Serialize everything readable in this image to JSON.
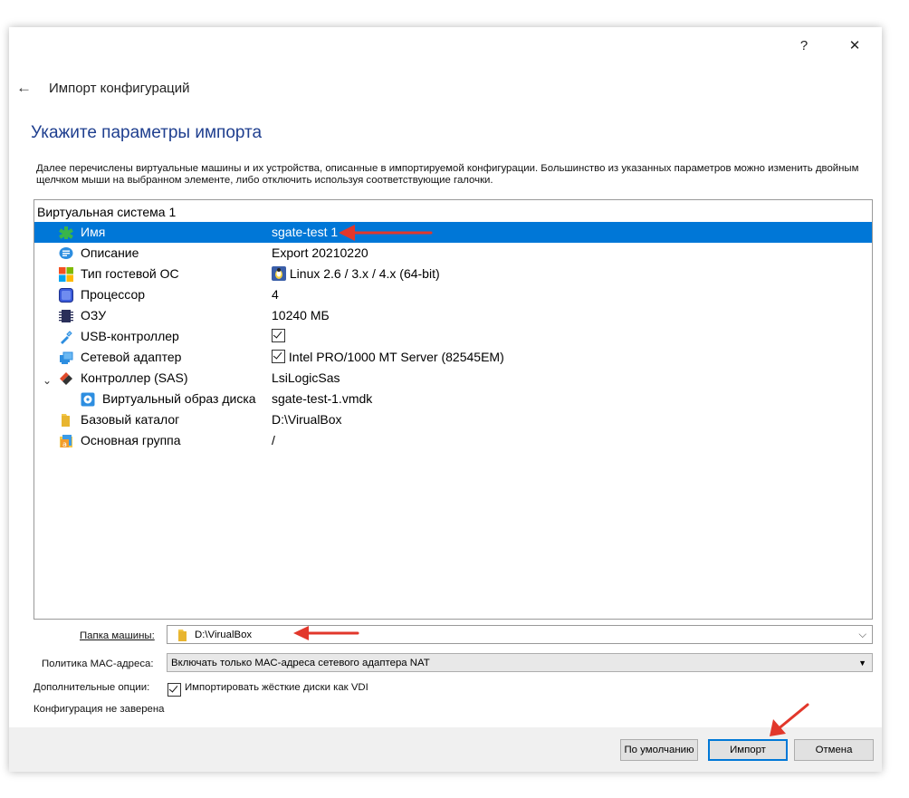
{
  "window": {
    "help_label": "?",
    "close_label": "✕",
    "back_label": "←",
    "title": "Импорт конфигураций"
  },
  "page": {
    "heading": "Укажите параметры импорта",
    "description": "Далее перечислены виртуальные машины и их устройства, описанные в импортируемой конфигурации. Большинство из указанных параметров можно изменить двойным щелчком мыши на выбранном элементе, либо отключить используя соответствующие галочки."
  },
  "tree": {
    "group_label": "Виртуальная система 1",
    "rows": [
      {
        "name": "Имя",
        "value": "sgate-test 1",
        "icon": "vm-name-icon"
      },
      {
        "name": "Описание",
        "value": "Export 20210220",
        "icon": "description-icon"
      },
      {
        "name": "Тип гостевой ОС",
        "value": "Linux 2.6 / 3.x / 4.x (64-bit)",
        "icon": "os-type-icon"
      },
      {
        "name": "Процессор",
        "value": "4",
        "icon": "cpu-icon"
      },
      {
        "name": "ОЗУ",
        "value": "10240 МБ",
        "icon": "ram-icon"
      },
      {
        "name": "USB-контроллер",
        "value": "",
        "icon": "usb-icon",
        "checked": true
      },
      {
        "name": "Сетевой адаптер",
        "value": "Intel PRO/1000 MT Server (82545EM)",
        "icon": "network-icon",
        "checked": true
      },
      {
        "name": "Контроллер (SAS)",
        "value": "LsiLogicSas",
        "icon": "storage-controller-icon"
      },
      {
        "name": "Виртуальный образ диска",
        "value": "sgate-test-1.vmdk",
        "icon": "disk-image-icon"
      },
      {
        "name": "Базовый каталог",
        "value": "D:\\VirualBox",
        "icon": "folder-icon"
      },
      {
        "name": "Основная группа",
        "value": "/",
        "icon": "group-icon"
      }
    ]
  },
  "settings": {
    "machine_folder_label": "Папка машины:",
    "machine_folder_value": "D:\\VirualBox",
    "mac_policy_label": "Политика MAC-адреса:",
    "mac_policy_value": "Включать только MAC-адреса сетевого адаптера NAT",
    "extra_options_label": "Дополнительные опции:",
    "import_vdi_label": "Импортировать жёсткие диски как VDI",
    "import_vdi_checked": true,
    "signature_status": "Конфигурация не заверена"
  },
  "buttons": {
    "defaults": "По умолчанию",
    "import": "Импорт",
    "cancel": "Отмена"
  },
  "colors": {
    "selection": "#0077d7",
    "heading": "#1f3f8f",
    "annotation_arrow": "#e2372b"
  }
}
